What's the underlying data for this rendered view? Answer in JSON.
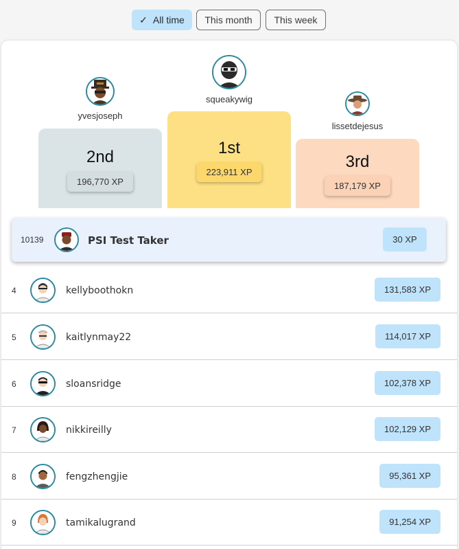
{
  "filters": {
    "all_time": "All time",
    "this_month": "This month",
    "this_week": "This week",
    "active": "all_time"
  },
  "podium": {
    "second": {
      "rank": "2nd",
      "username": "yvesjoseph",
      "xp": "196,770 XP",
      "avatar_icon": "steampunk-avatar-icon"
    },
    "first": {
      "rank": "1st",
      "username": "squeakywig",
      "xp": "223,911 XP",
      "avatar_icon": "ninja-avatar-icon"
    },
    "third": {
      "rank": "3rd",
      "username": "lissetdejesus",
      "xp": "187,179 XP",
      "avatar_icon": "cowboy-avatar-icon"
    }
  },
  "current_user": {
    "rank": "10139",
    "username": "PSI Test Taker",
    "xp": "30 XP",
    "avatar_icon": "user-avatar-icon"
  },
  "leaderboard": [
    {
      "rank": "4",
      "username": "kellyboothokn",
      "xp": "131,583 XP"
    },
    {
      "rank": "5",
      "username": "kaitlynmay22",
      "xp": "114,017 XP"
    },
    {
      "rank": "6",
      "username": "sloansridge",
      "xp": "102,378 XP"
    },
    {
      "rank": "7",
      "username": "nikkireilly",
      "xp": "102,129 XP"
    },
    {
      "rank": "8",
      "username": "fengzhengjie",
      "xp": "95,361 XP"
    },
    {
      "rank": "9",
      "username": "tamikalugrand",
      "xp": "91,254 XP"
    }
  ],
  "colors": {
    "active_filter": "#bfe3fb",
    "second_place": "#dae3e5",
    "first_place": "#fde083",
    "third_place": "#fdd9bf",
    "xp_badge": "#bfe3fb",
    "avatar_ring": "#2c8aa0"
  }
}
